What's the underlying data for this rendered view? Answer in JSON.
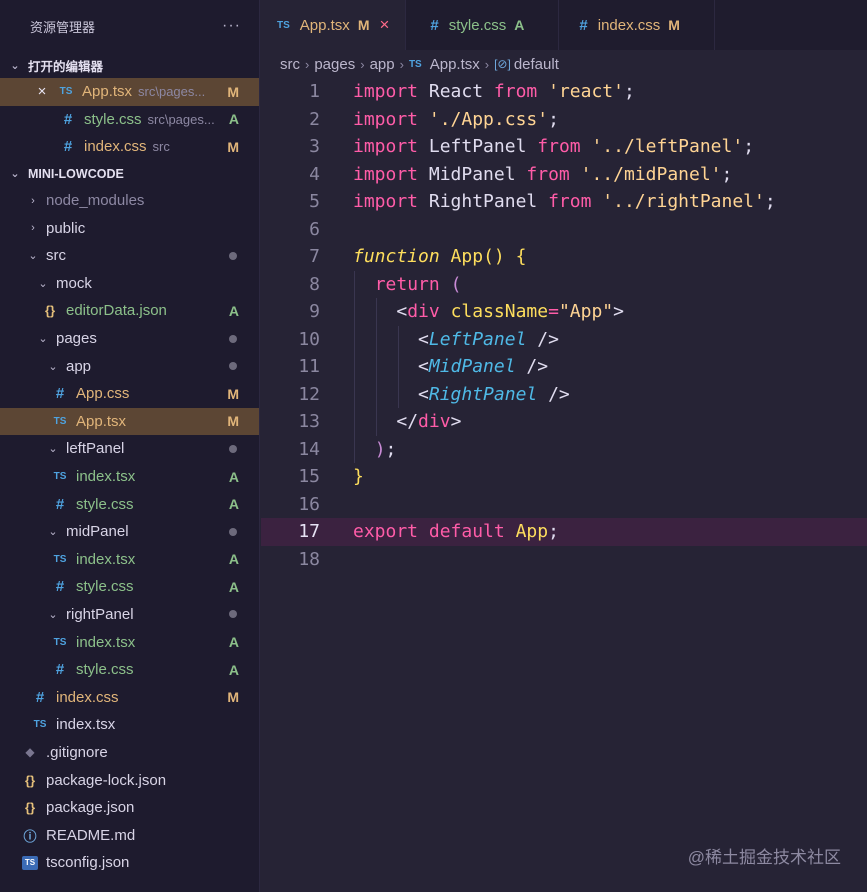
{
  "explorer": {
    "title": "资源管理器",
    "more": "···",
    "open_editors": {
      "header": "打开的编辑器",
      "items": [
        {
          "name": "App.tsx",
          "path": "src\\pages...",
          "status": "M",
          "type": "ts"
        },
        {
          "name": "style.css",
          "path": "src\\pages...",
          "status": "A",
          "type": "css"
        },
        {
          "name": "index.css",
          "path": "src",
          "status": "M",
          "type": "css"
        }
      ]
    },
    "project": {
      "header": "MINI-LOWCODE",
      "tree": [
        {
          "name": "node_modules"
        },
        {
          "name": "public"
        },
        {
          "name": "src"
        },
        {
          "name": "mock"
        },
        {
          "name": "editorData.json",
          "status": "A"
        },
        {
          "name": "pages"
        },
        {
          "name": "app"
        },
        {
          "name": "App.css",
          "status": "M"
        },
        {
          "name": "App.tsx",
          "status": "M"
        },
        {
          "name": "leftPanel"
        },
        {
          "name": "index.tsx",
          "status": "A"
        },
        {
          "name": "style.css",
          "status": "A"
        },
        {
          "name": "midPanel"
        },
        {
          "name": "index.tsx",
          "status": "A"
        },
        {
          "name": "style.css",
          "status": "A"
        },
        {
          "name": "rightPanel"
        },
        {
          "name": "index.tsx",
          "status": "A"
        },
        {
          "name": "style.css",
          "status": "A"
        },
        {
          "name": "index.css",
          "status": "M"
        },
        {
          "name": "index.tsx"
        },
        {
          "name": ".gitignore"
        },
        {
          "name": "package-lock.json"
        },
        {
          "name": "package.json"
        },
        {
          "name": "README.md"
        },
        {
          "name": "tsconfig.json"
        }
      ]
    }
  },
  "icons": {
    "ts": "TS",
    "css": "#",
    "json": "{}",
    "close": "×",
    "chevron_down": "⌄",
    "chevron_right": "›"
  },
  "tabs": [
    {
      "label": "App.tsx",
      "status": "M",
      "active": true
    },
    {
      "label": "style.css",
      "status": "A"
    },
    {
      "label": "index.css",
      "status": "M"
    }
  ],
  "breadcrumb": [
    "src",
    "pages",
    "app",
    "App.tsx",
    "default"
  ],
  "code": {
    "lines": [
      "1",
      "2",
      "3",
      "4",
      "5",
      "6",
      "7",
      "8",
      "9",
      "10",
      "11",
      "12",
      "13",
      "14",
      "15",
      "16",
      "17",
      "18"
    ],
    "current_line": 17,
    "tokens": {
      "import": "import",
      "from": "from",
      "react": "React",
      "react_str": "'react'",
      "app_css": "'./App.css'",
      "leftpanel": "LeftPanel",
      "leftpanel_str": "'../leftPanel'",
      "midpanel": "MidPanel",
      "midpanel_str": "'../midPanel'",
      "rightpanel": "RightPanel",
      "rightpanel_str": "'../rightPanel'",
      "function": "function",
      "app_fn": "App",
      "return": "return",
      "div": "div",
      "classname": "className",
      "app_str": "\"App\"",
      "export": "export",
      "default": "default",
      "app_export": "App"
    }
  },
  "watermark": "@稀土掘金技术社区",
  "colors": {
    "background": "#262335",
    "sidebar": "#1e1b2e",
    "modified": "#e1b57a",
    "added": "#8cc08a",
    "keyword": "#ff5ca8",
    "string": "#ffd494"
  }
}
